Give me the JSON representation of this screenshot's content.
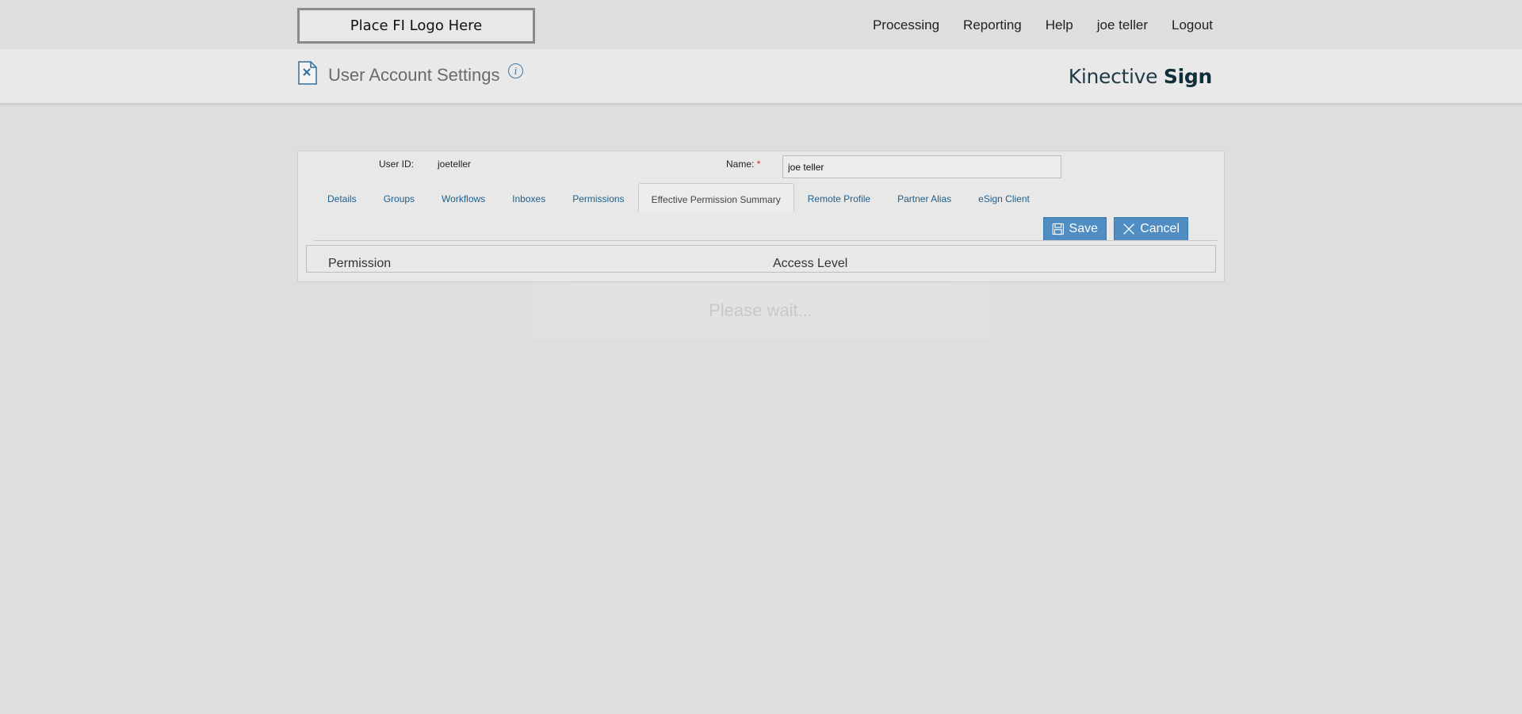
{
  "header": {
    "logo_text": "Place FI Logo Here",
    "nav": [
      "Processing",
      "Reporting",
      "Help",
      "joe teller",
      "Logout"
    ]
  },
  "title_bar": {
    "title": "User Account Settings",
    "page_icon": "document-x-icon",
    "info_icon": "info-icon",
    "brand_light": "Kinective",
    "brand_bold": "Sign"
  },
  "form": {
    "user_id_label": "User ID:",
    "user_id_value": "joeteller",
    "name_label": "Name:",
    "name_required_mark": "*",
    "name_value": "joe teller"
  },
  "tabs": [
    {
      "label": "Details",
      "active": false
    },
    {
      "label": "Groups",
      "active": false
    },
    {
      "label": "Workflows",
      "active": false
    },
    {
      "label": "Inboxes",
      "active": false
    },
    {
      "label": "Permissions",
      "active": false
    },
    {
      "label": "Effective Permission Summary",
      "active": true
    },
    {
      "label": "Remote Profile",
      "active": false
    },
    {
      "label": "Partner Alias",
      "active": false
    },
    {
      "label": "eSign Client",
      "active": false
    }
  ],
  "buttons": {
    "save_label": "Save",
    "cancel_label": "Cancel"
  },
  "table": {
    "columns": [
      "Permission",
      "Access Level"
    ]
  },
  "overlay": {
    "text": "Please wait..."
  },
  "colors": {
    "accent_button": "#4f8dc2",
    "link": "#1f5f8b",
    "brand": "#1f3b45",
    "background": "#dedede"
  }
}
